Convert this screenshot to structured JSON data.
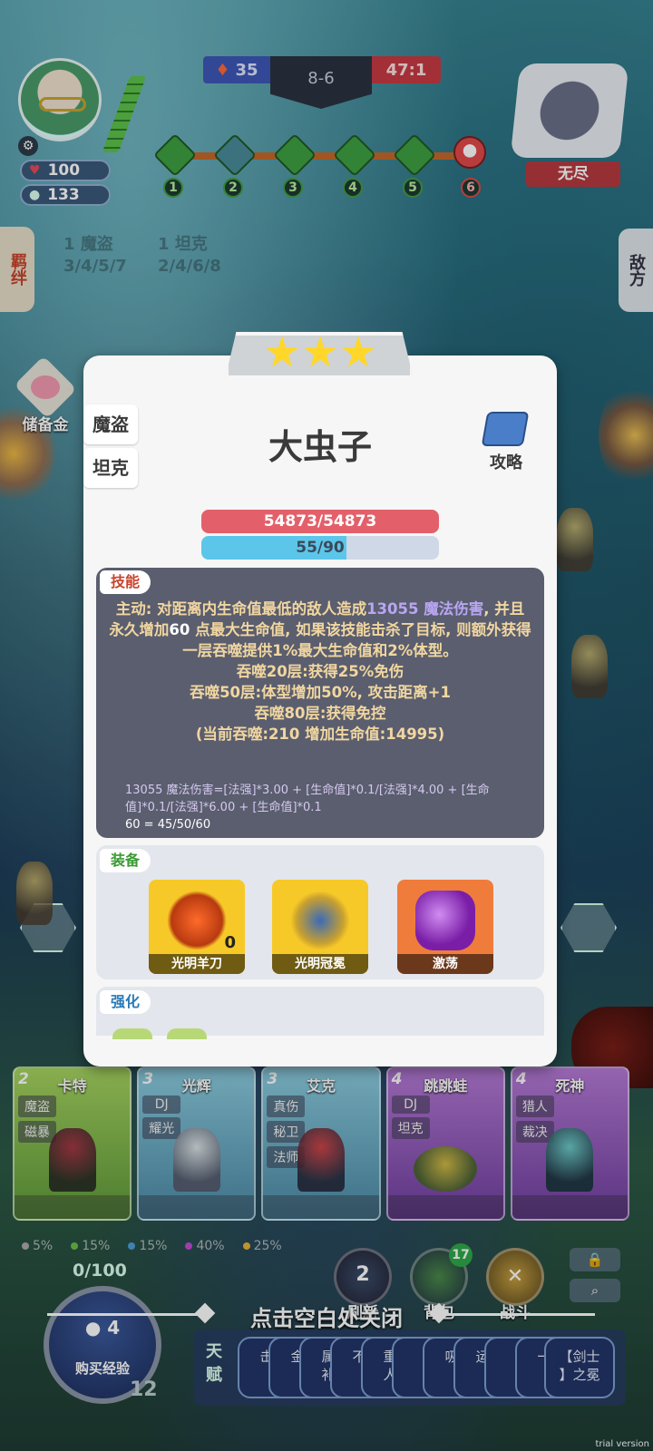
{
  "hud": {
    "health": "100",
    "gold": "133",
    "score_left": "35",
    "round": "8-6",
    "score_right": "47:1",
    "stages": [
      "1",
      "2",
      "3",
      "4",
      "5",
      "6"
    ],
    "opponent_label": "无尽"
  },
  "side": {
    "left_tab": "羁绊",
    "right_tab": "敌方",
    "savings_label": "储备金",
    "synergies": [
      {
        "count": "1",
        "name": "魔盗",
        "tiers": "3/4/5/7"
      },
      {
        "count": "1",
        "name": "坦克",
        "tiers": "2/4/6/8"
      }
    ]
  },
  "hero": {
    "stars": 3,
    "name": "大虫子",
    "traits": [
      "魔盗",
      "坦克"
    ],
    "guide_label": "攻略",
    "hp_text": "54873/54873",
    "mana_text": "55/90",
    "mana_fraction": 0.611,
    "skill_label": "技能",
    "skill_desc_prefix": "主动: 对距离内生命值最低的敌人造成",
    "skill_desc_highlight": "13055 魔法伤害",
    "skill_desc_rest1": ", 并且永久增加",
    "skill_desc_num": "60",
    "skill_desc_rest2": " 点最大生命值, 如果该技能击杀了目标, 则额外获得一层吞噬提供1%最大生命值和2%体型。",
    "skill_lines": [
      "吞噬20层:获得25%免伤",
      "吞噬50层:体型增加50%, 攻击距离+1",
      "吞噬80层:获得免控",
      "(当前吞噬:210 增加生命值:14995)"
    ],
    "formula_1_head": "13055 魔法伤害=",
    "formula_1_body": "[法强]*3.00 + [生命值]*0.1/[法强]*4.00 + [生命值]*0.1/[法强]*6.00 + [生命值]*0.1",
    "formula_2_head": "60",
    "formula_2_body": " = 45/50/60",
    "equip_label": "装备",
    "equipment": [
      {
        "name": "光明羊刀",
        "count": "0"
      },
      {
        "name": "光明冠冕"
      },
      {
        "name": "激荡"
      }
    ],
    "enhance_label": "强化"
  },
  "shop": {
    "cards": [
      {
        "cost": "2",
        "name": "卡特",
        "tags": [
          "魔盗",
          "磁暴"
        ]
      },
      {
        "cost": "3",
        "name": "光辉",
        "tags": [
          "DJ",
          "耀光"
        ]
      },
      {
        "cost": "3",
        "name": "艾克",
        "tags": [
          "真伤",
          "秘卫",
          "法师"
        ]
      },
      {
        "cost": "4",
        "name": "跳跳蛙",
        "tags": [
          "DJ",
          "坦克"
        ]
      },
      {
        "cost": "4",
        "name": "死神",
        "tags": [
          "猎人",
          "裁决"
        ]
      }
    ],
    "odds": [
      "5%",
      "15%",
      "15%",
      "40%",
      "25%"
    ],
    "odds_colors": [
      "#aaaaaa",
      "#6cc04a",
      "#4aa0d8",
      "#c24ad8",
      "#e8b23a"
    ],
    "exp_progress": "0/100",
    "buy_exp_cost": "4",
    "buy_exp_label": "购买经验",
    "level": "12",
    "refresh_cost": "2",
    "refresh_label": "刷新",
    "bag_label": "背包",
    "bag_count": "17",
    "battle_label": "战斗",
    "close_hint": "点击空白处关闭",
    "talent_label": "天赋",
    "talents": [
      "击",
      "金",
      "属\n补",
      "不",
      "重\n人",
      "【",
      "吸",
      "运",
      "【",
      "一",
      "【剑士\n】之冕"
    ],
    "trial": "trial version"
  }
}
